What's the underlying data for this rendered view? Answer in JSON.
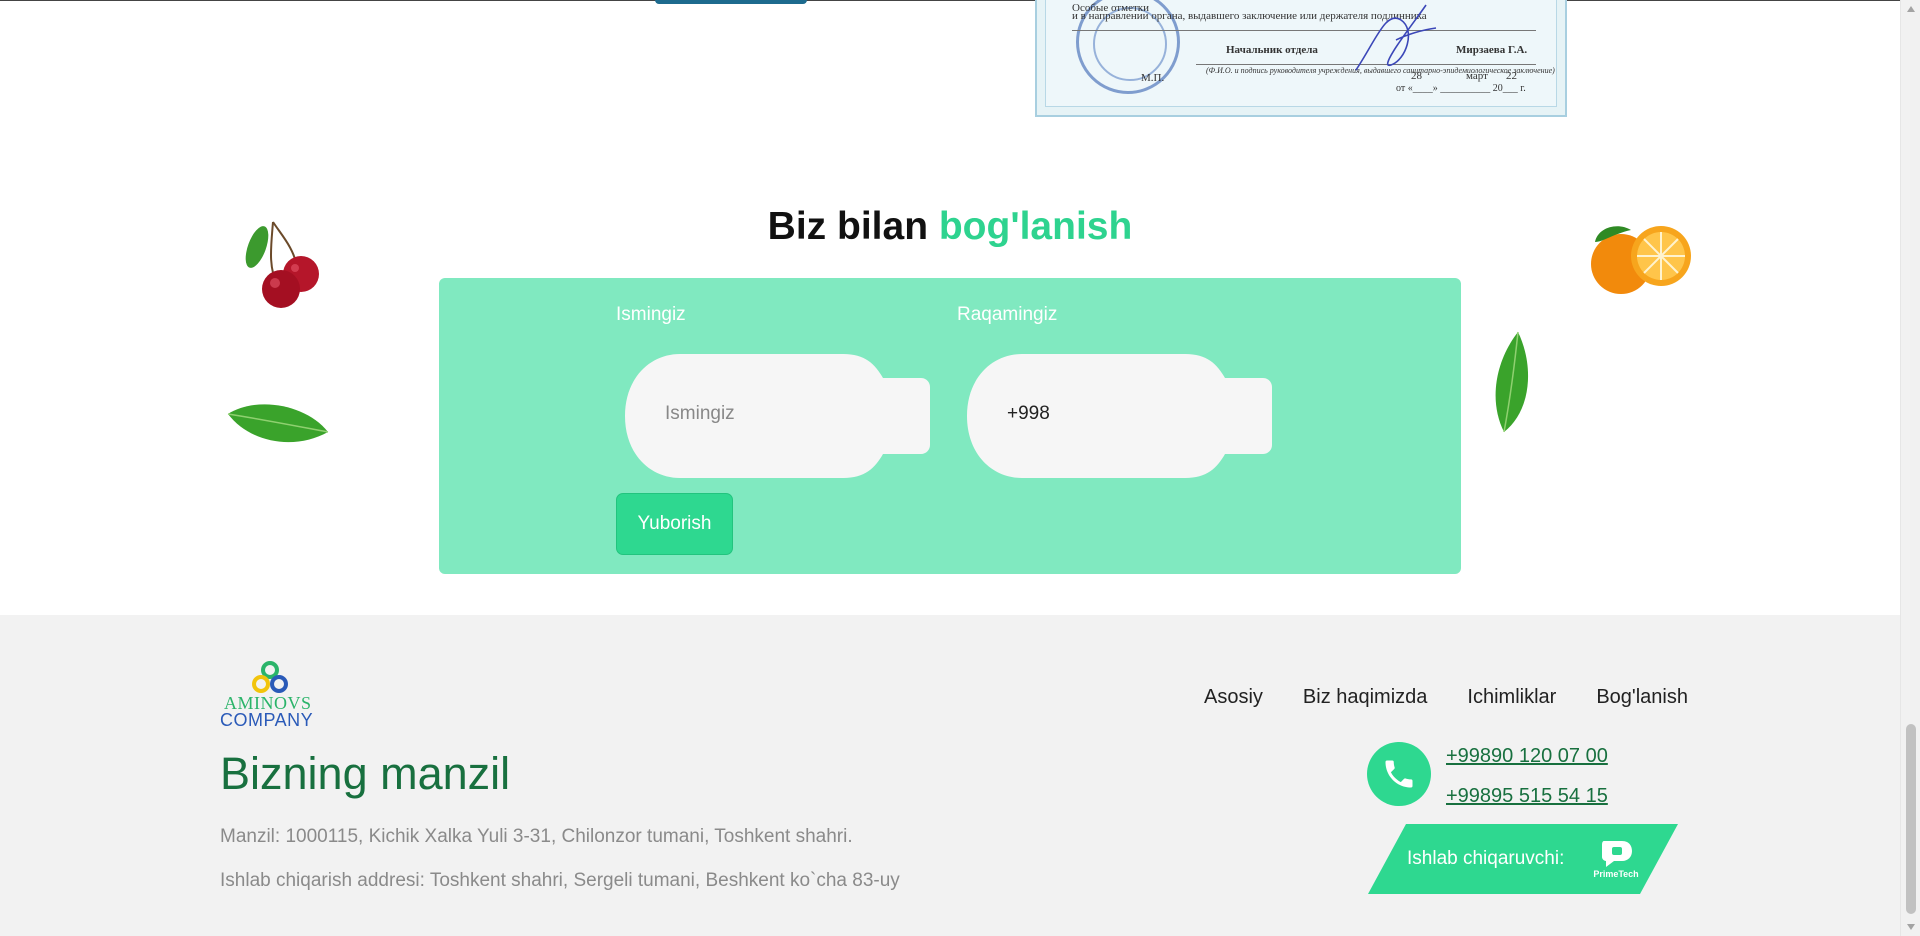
{
  "certificate": {
    "line1": "и в направлении органа, выдавшего заключение или держателя подлинника",
    "label_overlap": "Особые отметки",
    "position": "Начальник отдела",
    "name": "Мирзаева Г.А.",
    "caption": "(Ф.И.О. и подпись руководителя учреждения, выдавшего санитарно-эпидемиологическое заключение)",
    "mp": "М.П.",
    "day": "28",
    "month": "март",
    "year": "22",
    "date_line": "от «____» __________ 20___ г."
  },
  "contact": {
    "title_main": "Biz bilan",
    "title_accent": "bog'lanish",
    "name_label": "Ismingiz",
    "name_placeholder": "Ismingiz",
    "name_value": "",
    "phone_label": "Raqamingiz",
    "phone_value": "+998",
    "submit_label": "Yuborish"
  },
  "footer": {
    "logo_line1": "AMINOVS",
    "logo_line2": "COMPANY",
    "address_title": "Bizning manzil",
    "address": "Manzil: 1000115, Kichik Xalka Yuli 3-31, Chilonzor tumani, Toshkent shahri.",
    "production_address": "Ishlab chiqarish addresi: Toshkent shahri, Sergeli tumani, Beshkent ko`cha 83-uy",
    "nav": [
      "Asosiy",
      "Biz haqimizda",
      "Ichimliklar",
      "Bog'lanish"
    ],
    "phones": [
      "+99890 120 07 00",
      "+99895 515 54 15"
    ],
    "maker_label": "Ishlab chiqaruvchi:",
    "maker_brand": "PrimeTech"
  },
  "colors": {
    "accent": "#2ed38f",
    "form_bg": "#80e9c0",
    "footer_bg": "#f2f2f2",
    "dark_green": "#18703f"
  },
  "icons": [
    "cherry-image",
    "leaf-image",
    "orange-image",
    "phone-icon",
    "primetech-logo-icon",
    "aminovs-logo-icon"
  ]
}
